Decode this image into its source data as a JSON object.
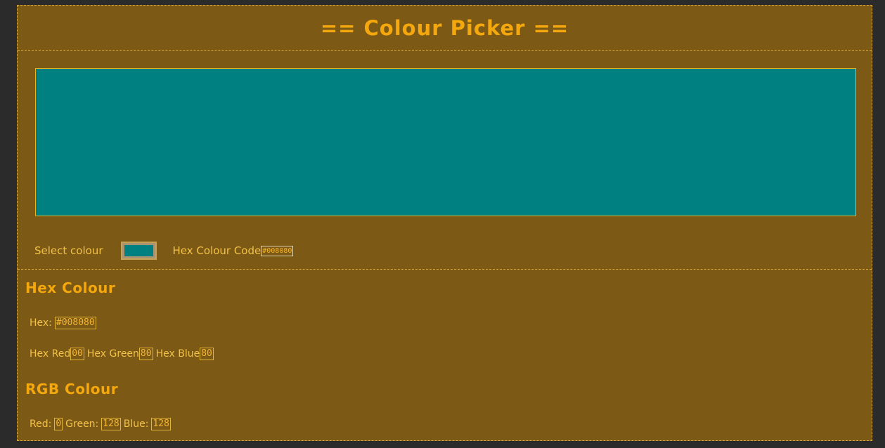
{
  "header": {
    "title": "== Colour Picker =="
  },
  "picker": {
    "preview_color": "#008080",
    "select_label": "Select colour",
    "hex_code_label": "Hex Colour Code",
    "hex_code_value": "#008080"
  },
  "hex_section": {
    "heading": "Hex Colour",
    "hex_label": "Hex:",
    "hex_value": "#008080",
    "red_label": "Hex Red",
    "red_value": "00",
    "green_label": "Hex Green",
    "green_value": "80",
    "blue_label": "Hex Blue",
    "blue_value": "80"
  },
  "rgb_section": {
    "heading": "RGB Colour",
    "red_label": "Red:",
    "red_value": "0",
    "green_label": "Green:",
    "green_value": "128",
    "blue_label": "Blue:",
    "blue_value": "128"
  },
  "colors": {
    "background": "#7c5914",
    "accent": "#f5a80d",
    "selected": "#008080"
  }
}
